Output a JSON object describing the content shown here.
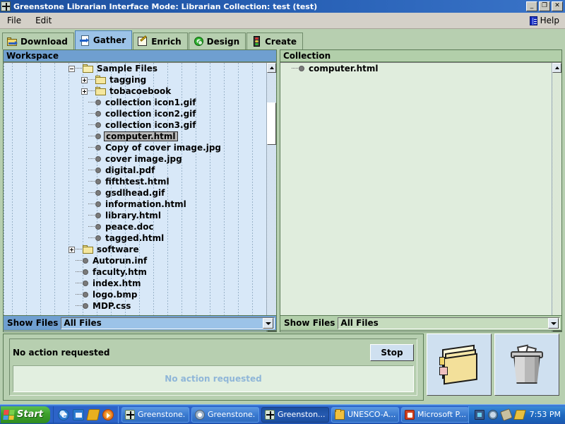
{
  "window": {
    "title": "Greenstone Librarian Interface  Mode: Librarian  Collection: test (test)",
    "minimize_label": "_",
    "restore_label": "❐",
    "close_label": "✕",
    "app_icon": "greenstone-logo-icon"
  },
  "menu": {
    "items": [
      {
        "label": "File"
      },
      {
        "label": "Edit"
      }
    ],
    "help_label": "Help",
    "help_icon": "book-icon"
  },
  "tabs": [
    {
      "label": "Download",
      "icon": "folder-arrow-icon",
      "active": false
    },
    {
      "label": "Gather",
      "icon": "page-arrow-icon",
      "active": true
    },
    {
      "label": "Enrich",
      "icon": "pencil-page-icon",
      "active": false
    },
    {
      "label": "Design",
      "icon": "gear-icon",
      "active": false
    },
    {
      "label": "Create",
      "icon": "traffic-light-icon",
      "active": false
    }
  ],
  "workspace": {
    "header": "Workspace",
    "tree": [
      {
        "label": "Sample Files",
        "depth": 0,
        "type": "folder",
        "toggle": "minus",
        "selected": false
      },
      {
        "label": "tagging",
        "depth": 1,
        "type": "folder",
        "toggle": "plus",
        "selected": false
      },
      {
        "label": "tobacoebook",
        "depth": 1,
        "type": "folder",
        "toggle": "plus",
        "selected": false
      },
      {
        "label": "collection icon1.gif",
        "depth": 1,
        "type": "file",
        "toggle": "none",
        "selected": false
      },
      {
        "label": "collection icon2.gif",
        "depth": 1,
        "type": "file",
        "toggle": "none",
        "selected": false
      },
      {
        "label": "collection icon3.gif",
        "depth": 1,
        "type": "file",
        "toggle": "none",
        "selected": false
      },
      {
        "label": "computer.html",
        "depth": 1,
        "type": "file",
        "toggle": "none",
        "selected": true
      },
      {
        "label": "Copy of cover image.jpg",
        "depth": 1,
        "type": "file",
        "toggle": "none",
        "selected": false
      },
      {
        "label": "cover image.jpg",
        "depth": 1,
        "type": "file",
        "toggle": "none",
        "selected": false
      },
      {
        "label": "digital.pdf",
        "depth": 1,
        "type": "file",
        "toggle": "none",
        "selected": false
      },
      {
        "label": "fifthtest.html",
        "depth": 1,
        "type": "file",
        "toggle": "none",
        "selected": false
      },
      {
        "label": "gsdlhead.gif",
        "depth": 1,
        "type": "file",
        "toggle": "none",
        "selected": false
      },
      {
        "label": "information.html",
        "depth": 1,
        "type": "file",
        "toggle": "none",
        "selected": false
      },
      {
        "label": "library.html",
        "depth": 1,
        "type": "file",
        "toggle": "none",
        "selected": false
      },
      {
        "label": "peace.doc",
        "depth": 1,
        "type": "file",
        "toggle": "none",
        "selected": false
      },
      {
        "label": "tagged.html",
        "depth": 1,
        "type": "file",
        "toggle": "none",
        "selected": false
      },
      {
        "label": "software",
        "depth": 0,
        "type": "folder",
        "toggle": "plus",
        "selected": false
      },
      {
        "label": "Autorun.inf",
        "depth": 0,
        "type": "file",
        "toggle": "none",
        "selected": false
      },
      {
        "label": "faculty.htm",
        "depth": 0,
        "type": "file",
        "toggle": "none",
        "selected": false
      },
      {
        "label": "index.htm",
        "depth": 0,
        "type": "file",
        "toggle": "none",
        "selected": false
      },
      {
        "label": "logo.bmp",
        "depth": 0,
        "type": "file",
        "toggle": "none",
        "selected": false
      },
      {
        "label": "MDP.css",
        "depth": 0,
        "type": "file",
        "toggle": "none",
        "selected": false
      }
    ],
    "show_files_label": "Show Files",
    "show_files_value": "All Files"
  },
  "collection": {
    "header": "Collection",
    "tree": [
      {
        "label": "computer.html",
        "depth": 0,
        "type": "file",
        "toggle": "none",
        "selected": false
      }
    ],
    "show_files_label": "Show Files",
    "show_files_value": "All Files"
  },
  "status": {
    "message": "No action requested",
    "progress_text": "No action requested",
    "stop_label": "Stop"
  },
  "action_buttons": [
    {
      "name": "new-folder-button",
      "icon": "folders-icon"
    },
    {
      "name": "delete-button",
      "icon": "trash-icon"
    }
  ],
  "taskbar": {
    "start_label": "Start",
    "quick_launch": [
      {
        "icon": "internet-explorer-icon"
      },
      {
        "icon": "outlook-express-icon"
      },
      {
        "icon": "media-icon"
      },
      {
        "icon": "windows-media-player-icon"
      }
    ],
    "tasks": [
      {
        "label": "Greenstone...",
        "icon": "greenstone-icon",
        "active": false
      },
      {
        "label": "Greenstone...",
        "icon": "cd-icon",
        "active": false
      },
      {
        "label": "Greenston...",
        "icon": "greenstone-icon",
        "active": true
      },
      {
        "label": "UNESCO-A...",
        "icon": "folder-icon",
        "active": false
      },
      {
        "label": "Microsoft P...",
        "icon": "powerpoint-icon",
        "active": false
      }
    ],
    "tray_icons": [
      {
        "icon": "network-icon"
      },
      {
        "icon": "volume-icon"
      },
      {
        "icon": "plug-icon"
      },
      {
        "icon": "pen-icon"
      }
    ],
    "clock": "7:53 PM"
  },
  "colors": {
    "titlebar": "#2a63b8",
    "tab_active": "#9cc3e8",
    "panel_green": "#b7cfb0",
    "workspace_bg": "#d8e8f8",
    "collection_bg": "#e0eddd",
    "progress_text": "#8fb6d8"
  }
}
